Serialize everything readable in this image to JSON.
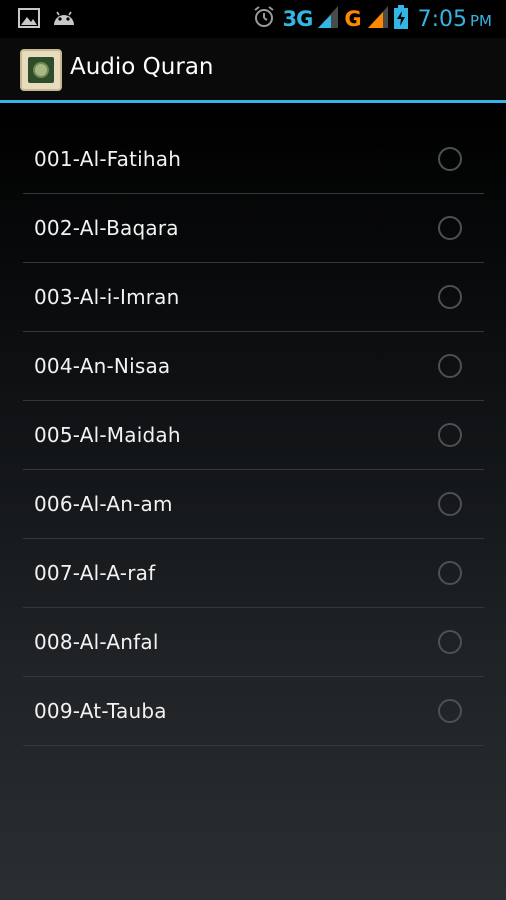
{
  "status_bar": {
    "left_icons": [
      "image-icon",
      "android-icon"
    ],
    "right_icons": [
      "alarm-icon",
      "signal-icon",
      "battery-charging-icon"
    ],
    "network_1": "3G",
    "network_2": "G",
    "time": "7:05",
    "ampm": "PM",
    "colors": {
      "network_1": "#33b5e5",
      "network_2": "#ff8800",
      "time": "#33b5e5"
    }
  },
  "action_bar": {
    "title": "Audio Quran",
    "icon": "quran-book-icon",
    "divider_color": "#33b5e5"
  },
  "surahs": [
    {
      "label": "001-Al-Fatihah",
      "selected": false
    },
    {
      "label": "002-Al-Baqara",
      "selected": false
    },
    {
      "label": "003-Al-i-Imran",
      "selected": false
    },
    {
      "label": "004-An-Nisaa",
      "selected": false
    },
    {
      "label": "005-Al-Maidah",
      "selected": false
    },
    {
      "label": "006-Al-An-am",
      "selected": false
    },
    {
      "label": "007-Al-A-raf",
      "selected": false
    },
    {
      "label": "008-Al-Anfal",
      "selected": false
    },
    {
      "label": "009-At-Tauba",
      "selected": false
    }
  ]
}
